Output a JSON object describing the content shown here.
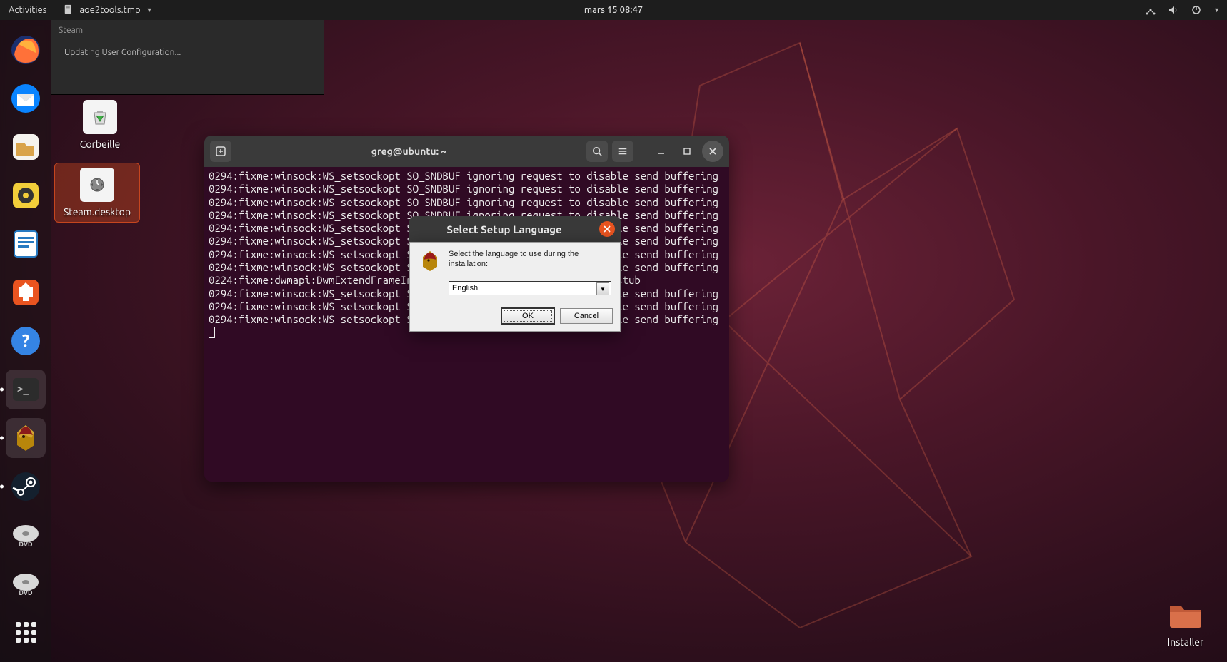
{
  "topbar": {
    "activities": "Activities",
    "app_name": "aoe2tools.tmp",
    "clock": "mars 15  08:47"
  },
  "dock": {
    "items": [
      {
        "name": "firefox"
      },
      {
        "name": "thunderbird"
      },
      {
        "name": "files"
      },
      {
        "name": "rhythmbox"
      },
      {
        "name": "libreoffice-writer"
      },
      {
        "name": "software"
      },
      {
        "name": "help"
      },
      {
        "name": "terminal"
      },
      {
        "name": "spartan"
      },
      {
        "name": "steam"
      },
      {
        "name": "dvd1"
      },
      {
        "name": "dvd2"
      }
    ]
  },
  "desktop": {
    "trash_label": "Corbeille",
    "steam_label": "Steam.desktop",
    "installer_label": "Installer"
  },
  "steam_popup": {
    "title": "Steam",
    "message": "Updating User Configuration..."
  },
  "terminal": {
    "title": "greg@ubuntu: ~",
    "lines": [
      "0294:fixme:winsock:WS_setsockopt SO_SNDBUF ignoring request to disable send buffering",
      "0294:fixme:winsock:WS_setsockopt SO_SNDBUF ignoring request to disable send buffering",
      "0294:fixme:winsock:WS_setsockopt SO_SNDBUF ignoring request to disable send buffering",
      "0294:fixme:winsock:WS_setsockopt SO_SNDBUF ignoring request to disable send buffering",
      "0294:fixme:winsock:WS_setsockopt SO_SNDBUF ignoring request to disable send buffering",
      "0294:fixme:winsock:WS_setsockopt SO_SNDBUF ignoring request to disable send buffering",
      "0294:fixme:winsock:WS_setsockopt SO_SNDBUF ignoring request to disable send buffering",
      "0294:fixme:winsock:WS_setsockopt SO_SNDBUF ignoring request to disable send buffering",
      "0224:fixme:dwmapi:DwmExtendFrameIntoClientArea (00030166, 009BE29C) stub",
      "0294:fixme:winsock:WS_setsockopt SO_SNDBUF ignoring request to disable send buffering",
      "0294:fixme:winsock:WS_setsockopt SO_SNDBUF ignoring request to disable send buffering",
      "0294:fixme:winsock:WS_setsockopt SO_SNDBUF ignoring request to disable send buffering"
    ]
  },
  "lang_dialog": {
    "title": "Select Setup Language",
    "prompt": "Select the language to use during the installation:",
    "selected": "English",
    "ok": "OK",
    "cancel": "Cancel"
  }
}
